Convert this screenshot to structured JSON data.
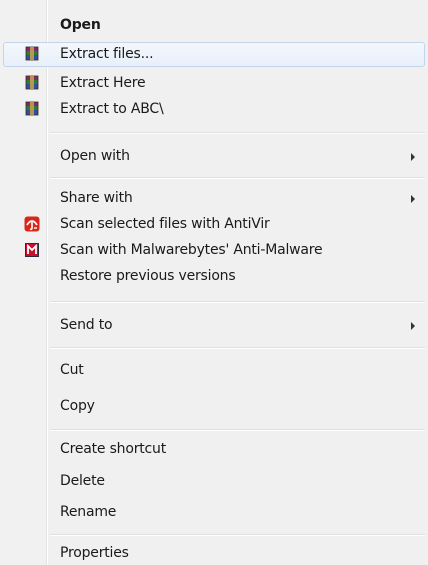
{
  "menu": {
    "items": [
      {
        "label": "Open",
        "icon": "",
        "bold": true,
        "submenu": false
      },
      {
        "label": "Extract files...",
        "icon": "winrar-icon",
        "highlighted": true,
        "submenu": false
      },
      {
        "label": "Extract Here",
        "icon": "winrar-icon",
        "submenu": false
      },
      {
        "label": "Extract to ABC\\",
        "icon": "winrar-icon",
        "submenu": false
      },
      {
        "label": "Open with",
        "icon": "",
        "submenu": true
      },
      {
        "label": "Share with",
        "icon": "",
        "submenu": true
      },
      {
        "label": "Scan selected files with AntiVir",
        "icon": "antivir-umbrella-icon",
        "submenu": false
      },
      {
        "label": "Scan with Malwarebytes' Anti-Malware",
        "icon": "malwarebytes-icon",
        "submenu": false
      },
      {
        "label": "Restore previous versions",
        "icon": "",
        "submenu": false
      },
      {
        "label": "Send to",
        "icon": "",
        "submenu": true
      },
      {
        "label": "Cut",
        "icon": "",
        "submenu": false
      },
      {
        "label": "Copy",
        "icon": "",
        "submenu": false
      },
      {
        "label": "Create shortcut",
        "icon": "",
        "submenu": false
      },
      {
        "label": "Delete",
        "icon": "",
        "submenu": false
      },
      {
        "label": "Rename",
        "icon": "",
        "submenu": false
      },
      {
        "label": "Properties",
        "icon": "",
        "submenu": false
      }
    ]
  },
  "colors": {
    "menu_background": "#f0f0f0",
    "highlight_border": "#c3d5ec",
    "antivir_red": "#d9261c",
    "malwarebytes_red": "#c8102e"
  }
}
